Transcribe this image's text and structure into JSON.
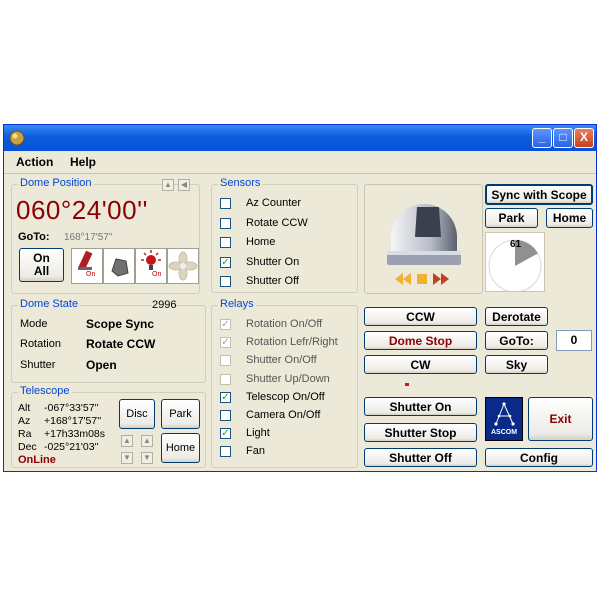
{
  "menu": {
    "action": "Action",
    "help": "Help"
  },
  "titlebar": {
    "minimize": "_",
    "maximize": "□",
    "close": "X"
  },
  "dome_position": {
    "title": "Dome Position",
    "azimuth": "060°24'00''",
    "goto_label": "GoTo:",
    "goto_value": "168°17'57''",
    "on_all": "On All",
    "icon_on_1": "On",
    "icon_on_2": "On"
  },
  "dome_state": {
    "title": "Dome State",
    "count": "2996",
    "mode_label": "Mode",
    "mode_value": "Scope Sync",
    "rotation_label": "Rotation",
    "rotation_value": "Rotate CCW",
    "shutter_label": "Shutter",
    "shutter_value": "Open"
  },
  "telescope": {
    "title": "Telescope",
    "alt_label": "Alt",
    "alt_value": "-067°33'57''",
    "az_label": "Az",
    "az_value": "+168°17'57''",
    "ra_label": "Ra",
    "ra_value": "+17h33m08s",
    "dec_label": "Dec",
    "dec_value": "-025°21'03''",
    "status": "OnLine",
    "disc": "Disc",
    "park": "Park",
    "home": "Home"
  },
  "sensors": {
    "title": "Sensors",
    "items": [
      {
        "label": "Az Counter",
        "checked": false
      },
      {
        "label": "Rotate CCW",
        "checked": false
      },
      {
        "label": "Home",
        "checked": false
      },
      {
        "label": "Shutter On",
        "checked": true
      },
      {
        "label": "Shutter Off",
        "checked": false
      }
    ]
  },
  "relays": {
    "title": "Relays",
    "items": [
      {
        "label": "Rotation On/Off",
        "checked": true
      },
      {
        "label": "Rotation Lefr/Right",
        "checked": true
      },
      {
        "label": "Shutter On/Off",
        "checked": false
      },
      {
        "label": "Shutter Up/Down",
        "checked": false
      },
      {
        "label": "Telescop On/Off",
        "checked": true
      },
      {
        "label": "Camera On/Off",
        "checked": false
      },
      {
        "label": "Light",
        "checked": true
      },
      {
        "label": "Fan",
        "checked": false
      }
    ]
  },
  "controls": {
    "sync_with_scope": "Sync with Scope",
    "park": "Park",
    "home": "Home",
    "gauge_value": "61",
    "gauge_fraction": 0.17,
    "ccw": "CCW",
    "dome_stop": "Dome Stop",
    "cw": "CW",
    "derotate": "Derotate",
    "goto": "GoTo:",
    "goto_value": "0",
    "sky": "Sky",
    "shutter_on": "Shutter On",
    "shutter_stop": "Shutter Stop",
    "shutter_off": "Shutter Off",
    "ascom": "ASCOM",
    "exit": "Exit",
    "config": "Config"
  },
  "colors": {
    "accent_blue": "#0046d5",
    "dark_red": "#8b0000",
    "title_blue": "#0a5ce0"
  }
}
